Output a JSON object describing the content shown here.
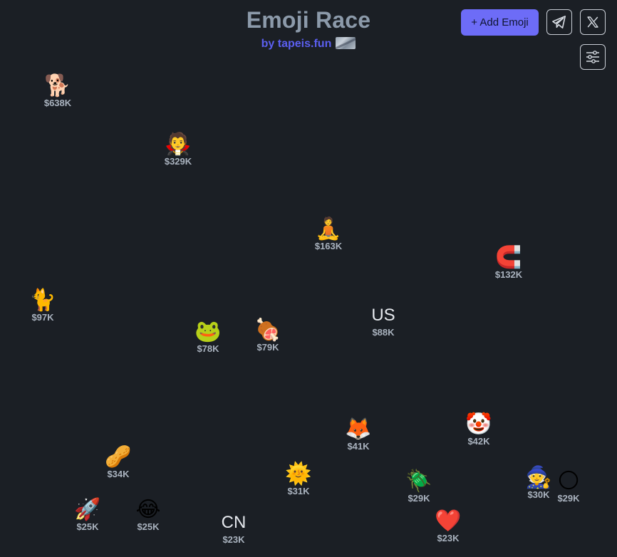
{
  "header": {
    "title": "Emoji Race",
    "subtitle": "by tapeis.fun"
  },
  "toolbar": {
    "add_label": "+ Add Emoji",
    "telegram_icon": "telegram-icon",
    "x_icon": "x-logo-icon",
    "filter_icon": "sliders-icon"
  },
  "tokens": [
    {
      "symbol": "🐕",
      "price": "$638K"
    },
    {
      "symbol": "🧛",
      "price": "$329K"
    },
    {
      "symbol": "🧘",
      "price": "$163K"
    },
    {
      "symbol": "🧲",
      "price": "$132K"
    },
    {
      "symbol": "🐈",
      "price": "$97K"
    },
    {
      "symbol": "US",
      "price": "$88K"
    },
    {
      "symbol": "🐸",
      "price": "$78K"
    },
    {
      "symbol": "🍖",
      "price": "$79K"
    },
    {
      "symbol": "🤡",
      "price": "$42K"
    },
    {
      "symbol": "🦊",
      "price": "$41K"
    },
    {
      "symbol": "🥜",
      "price": "$34K"
    },
    {
      "symbol": "🌞",
      "price": "$31K"
    },
    {
      "symbol": "🪲",
      "price": "$29K"
    },
    {
      "symbol": "🧙",
      "price": "$30K"
    },
    {
      "symbol": "🌕",
      "price": "$29K"
    },
    {
      "symbol": "🚀",
      "price": "$25K"
    },
    {
      "symbol": "😂",
      "price": "$25K"
    },
    {
      "symbol": "CN",
      "price": "$23K"
    },
    {
      "symbol": "❤️",
      "price": "$23K"
    }
  ],
  "colors": {
    "background": "#1b1f25",
    "accent": "#6d6cf7",
    "title": "#8c9aaa",
    "price": "#a9b2be"
  }
}
